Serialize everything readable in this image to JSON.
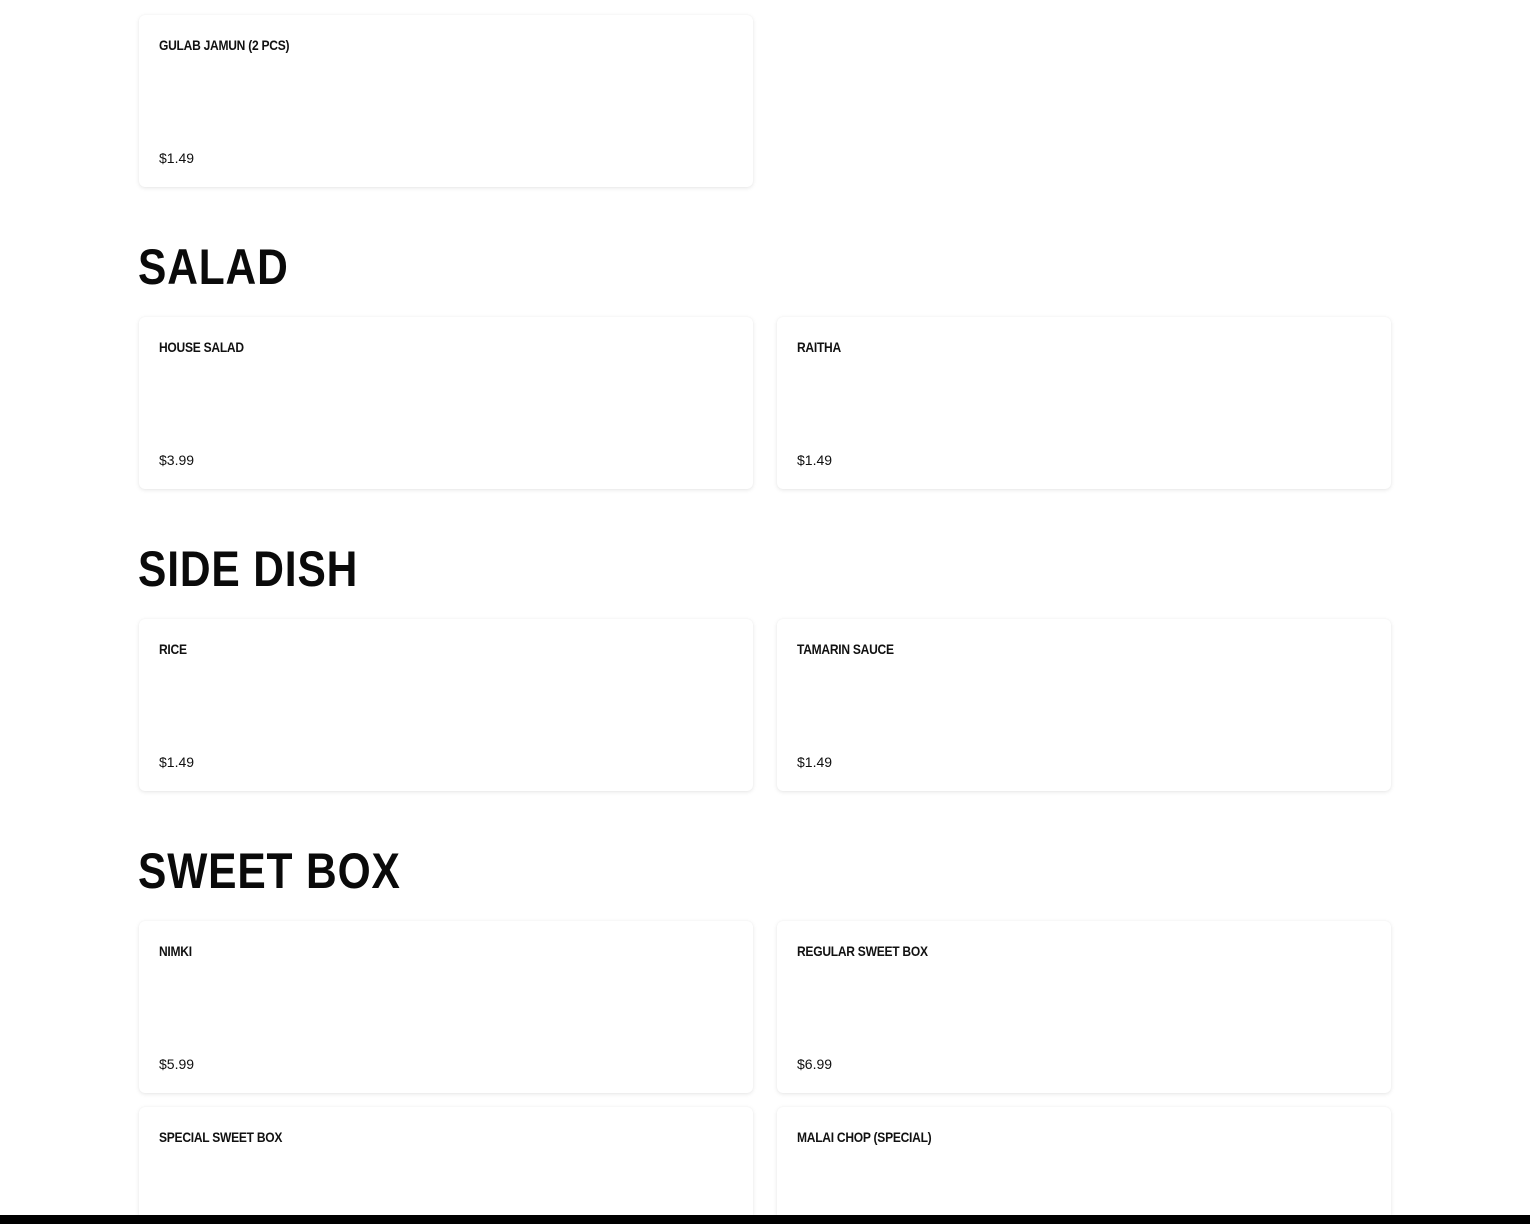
{
  "top_items": [
    {
      "name": "GULAB JAMUN (2 PCS)",
      "price": "$1.49"
    }
  ],
  "sections": [
    {
      "title": "SALAD",
      "items": [
        {
          "name": "HOUSE SALAD",
          "price": "$3.99"
        },
        {
          "name": "RAITHA",
          "price": "$1.49"
        }
      ]
    },
    {
      "title": "SIDE DISH",
      "items": [
        {
          "name": "RICE",
          "price": "$1.49"
        },
        {
          "name": "TAMARIN SAUCE",
          "price": "$1.49"
        }
      ]
    },
    {
      "title": "SWEET BOX",
      "items": [
        {
          "name": "NIMKI",
          "price": "$5.99"
        },
        {
          "name": "REGULAR SWEET BOX",
          "price": "$6.99"
        },
        {
          "name": "SPECIAL SWEET BOX",
          "price": ""
        },
        {
          "name": "MALAI CHOP (SPECIAL)",
          "price": ""
        }
      ]
    }
  ]
}
